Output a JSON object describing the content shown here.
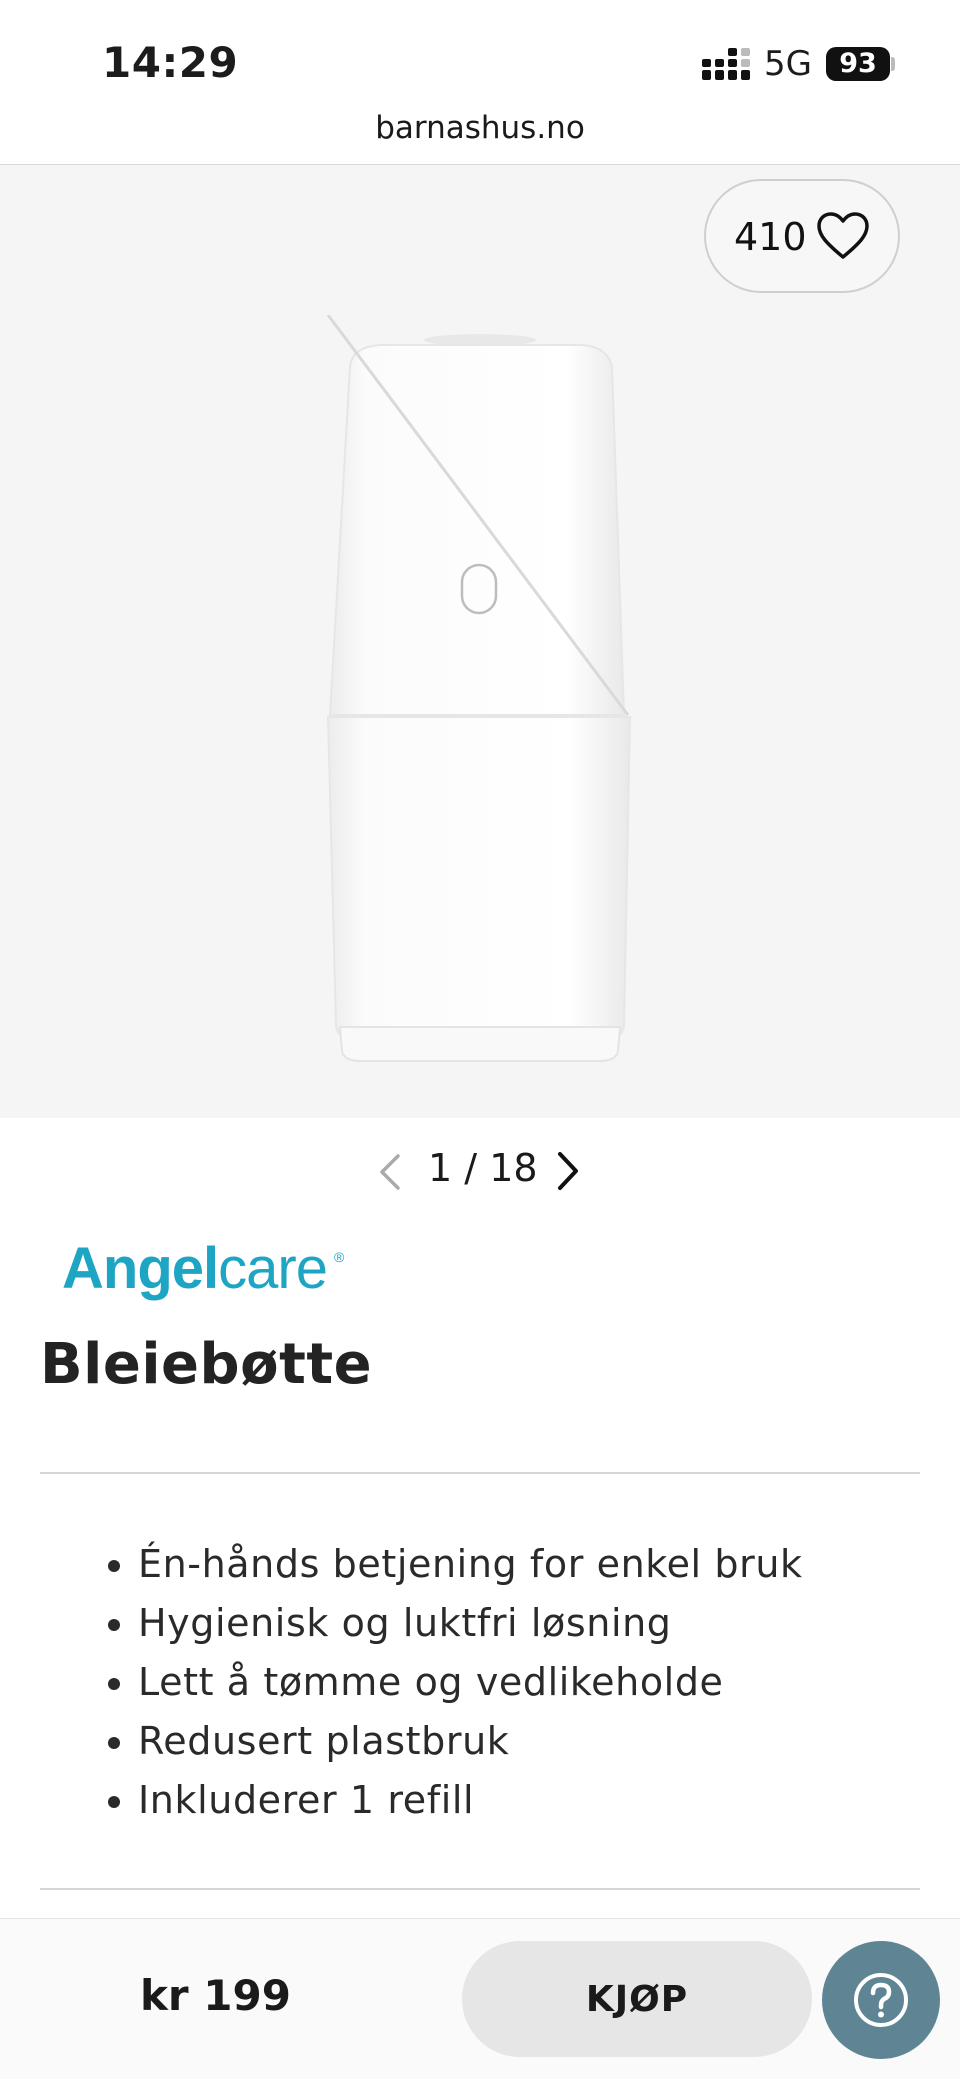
{
  "status_bar": {
    "time": "14:29",
    "network": "5G",
    "battery": "93"
  },
  "browser": {
    "url": "barnashus.no"
  },
  "gallery": {
    "favorites_count": "410",
    "current": "1",
    "separator": "/",
    "total": "18"
  },
  "product": {
    "brand": {
      "name_part1": "Angel",
      "name_part2": "care",
      "registered": "®"
    },
    "title": "Bleiebøtte",
    "features": [
      "Én-hånds betjening for enkel bruk",
      "Hygienisk og luktfri løsning",
      "Lett å tømme og vedlikeholde",
      "Redusert plastbruk",
      "Inkluderer 1 refill"
    ]
  },
  "purchase": {
    "price": "kr 199",
    "buy_label": "KJØP"
  },
  "colors": {
    "brand": "#1fa5c4",
    "help_button": "#5f8594",
    "hero_background": "#f5f5f5"
  },
  "icons": [
    "signal-icon",
    "heart-icon",
    "chevron-left-icon",
    "chevron-right-icon",
    "question-icon"
  ]
}
